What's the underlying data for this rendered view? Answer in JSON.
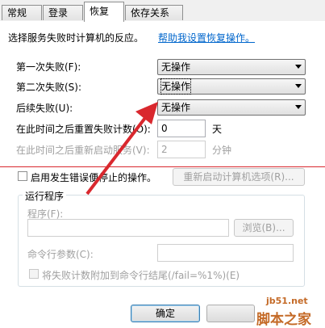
{
  "tabs": [
    "常规",
    "登录",
    "恢复",
    "依存关系"
  ],
  "intro": {
    "text": "选择服务失败时计算机的反应。",
    "help_link": "帮助我设置恢复操作。"
  },
  "failures": {
    "first_label": "第一次失败(F):",
    "first_value": "无操作",
    "second_label": "第二次失败(S):",
    "second_value": "无操作",
    "subsequent_label": "后续失败(U):",
    "subsequent_value": "无操作"
  },
  "reset": {
    "label": "在此时间之后重置失败计数(O):",
    "value": "0",
    "unit": "天"
  },
  "restart": {
    "label": "在此时间之后重新启动服务(V):",
    "value": "2",
    "unit": "分钟"
  },
  "stop_errors": {
    "label": "启用发生错误便停止的操作。",
    "restart_options_button": "重新启动计算机选项(R)..."
  },
  "run_program": {
    "group_title": "运行程序",
    "program_label": "程序(F):",
    "browse_button": "浏览(B)...",
    "cmdline_label": "命令行参数(C):",
    "append_label": "将失败计数附加到命令行结尾(/fail=%1%)(E)"
  },
  "footer": {
    "ok_button": "确定"
  },
  "watermark": {
    "site": "jb51.net",
    "brand": "脚本之家"
  },
  "colors": {
    "arrow": "#d9282e",
    "link": "#0066cc"
  }
}
